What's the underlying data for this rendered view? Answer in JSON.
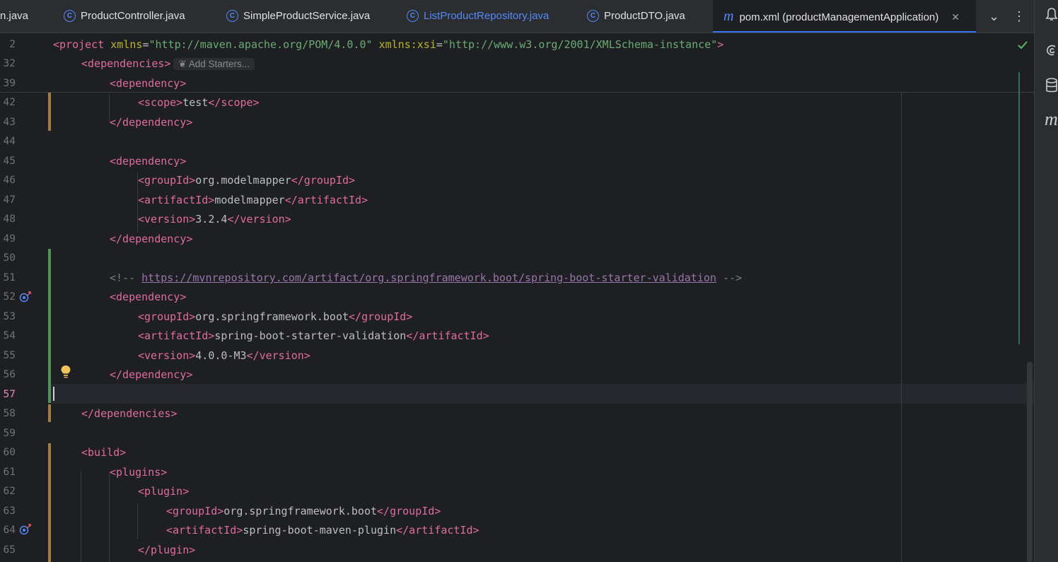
{
  "tabs": [
    {
      "label": "n.java",
      "icon": "none"
    },
    {
      "label": "ProductController.java",
      "icon": "class-icon"
    },
    {
      "label": "SimpleProductService.java",
      "icon": "class-icon"
    },
    {
      "label": "ListProductRepository.java",
      "icon": "class-icon"
    },
    {
      "label": "ProductDTO.java",
      "icon": "class-icon"
    },
    {
      "label": "pom.xml (productManagementApplication)",
      "icon": "maven-icon",
      "active": true
    }
  ],
  "tab_icons": {
    "class": "C",
    "maven": "m",
    "close": "✕",
    "chevron": "⌄",
    "more": "⋮"
  },
  "inline_hint": "Add Starters...",
  "lines": [
    {
      "n": "2"
    },
    {
      "n": "32"
    },
    {
      "n": "39"
    },
    {
      "n": "42"
    },
    {
      "n": "43"
    },
    {
      "n": "44"
    },
    {
      "n": "45"
    },
    {
      "n": "46"
    },
    {
      "n": "47"
    },
    {
      "n": "48"
    },
    {
      "n": "49"
    },
    {
      "n": "50"
    },
    {
      "n": "51"
    },
    {
      "n": "52"
    },
    {
      "n": "53"
    },
    {
      "n": "54"
    },
    {
      "n": "55"
    },
    {
      "n": "56"
    },
    {
      "n": "57",
      "current": true
    },
    {
      "n": "58"
    },
    {
      "n": "59"
    },
    {
      "n": "60"
    },
    {
      "n": "61"
    },
    {
      "n": "62"
    },
    {
      "n": "63"
    },
    {
      "n": "64"
    },
    {
      "n": "65"
    }
  ],
  "code": {
    "l2": {
      "open": "<project ",
      "attr1": "xmlns",
      "eq1": "=",
      "val1": "\"http://maven.apache.org/POM/4.0.0\"",
      "sp": " ",
      "attr2a": "xmlns:",
      "attr2b": "xsi",
      "eq2": "=",
      "val2": "\"http://www.w3.org/2001/XMLSchema-instance\""
    },
    "l32": "<dependencies>",
    "l39": "<dependency>",
    "l42": {
      "o": "<scope>",
      "t": "test",
      "c": "</scope>"
    },
    "l43": "</dependency>",
    "l45": "<dependency>",
    "l46": {
      "o": "<groupId>",
      "t": "org.modelmapper",
      "c": "</groupId>"
    },
    "l47": {
      "o": "<artifactId>",
      "t": "modelmapper",
      "c": "</artifactId>"
    },
    "l48": {
      "o": "<version>",
      "t": "3.2.4",
      "c": "</version>"
    },
    "l49": "</dependency>",
    "l51": {
      "o": "<!-- ",
      "link": "https://mvnrepository.com/artifact/org.springframework.boot/spring-boot-starter-validation",
      "c": " -->"
    },
    "l52": "<dependency>",
    "l53": {
      "o": "<groupId>",
      "t": "org.springframework.boot",
      "c": "</groupId>"
    },
    "l54": {
      "o": "<artifactId>",
      "t": "spring-boot-starter-validation",
      "c": "</artifactId>"
    },
    "l55": {
      "o": "<version>",
      "t": "4.0.0-M3",
      "c": "</version>"
    },
    "l56": "</dependency>",
    "l58": "</dependencies>",
    "l60": "<build>",
    "l61": "<plugins>",
    "l62": "<plugin>",
    "l63": {
      "o": "<groupId>",
      "t": "org.springframework.boot",
      "c": "</groupId>"
    },
    "l64": {
      "o": "<artifactId>",
      "t": "spring-boot-maven-plugin",
      "c": "</artifactId>"
    },
    "l65": "</plugin>"
  },
  "colors": {
    "tag": "#e06c9f",
    "attr": "#bbb529",
    "value": "#6aab73",
    "text": "#bcbec4",
    "comment": "#7a7e85",
    "accent": "#3574f0",
    "added": "#549159",
    "modified": "#a37a4a"
  }
}
